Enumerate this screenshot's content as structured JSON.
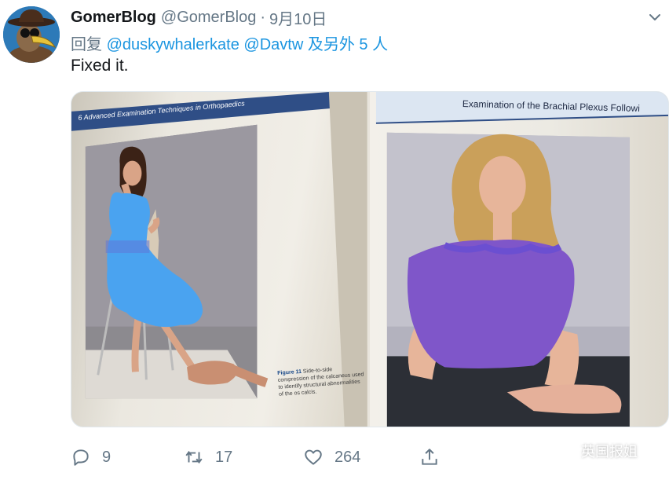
{
  "tweet": {
    "author": {
      "display_name": "GomerBlog",
      "handle": "@GomerBlog",
      "avatar_icon": "pelican-doctor-avatar"
    },
    "separator": "·",
    "date": "9月10日",
    "reply": {
      "prefix": "回复",
      "mention_1": "@duskywhalerkate",
      "mention_2": "@Davtw",
      "suffix": "及另外 5 人"
    },
    "text": "Fixed it.",
    "media": {
      "left_page_header": "Advanced Examination Techniques in Orthopaedics",
      "left_page_number": "6",
      "caption_title": "Figure 11",
      "caption_body": "Side-to-side compression of the calcaneus used to identify structural abnormalities of the os calcis.",
      "right_page_header": "Examination of the Brachial Plexus Followi"
    },
    "actions": {
      "reply_count": "9",
      "retweet_count": "17",
      "like_count": "264"
    },
    "watermark": "英国报姐",
    "colors": {
      "link": "#1b95e0",
      "muted": "#657786",
      "blue_dress_overlay": "#4aa3f0",
      "purple_top_overlay": "#7f56c9"
    }
  }
}
